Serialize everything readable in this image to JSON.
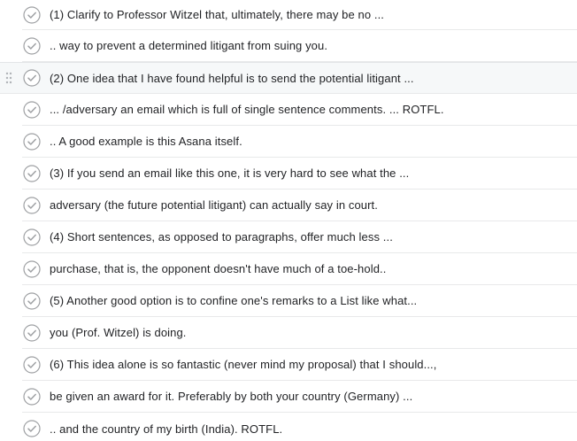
{
  "tasks": [
    {
      "text": "(1) Clarify to Professor Witzel that, ultimately, there may be no ..."
    },
    {
      "text": ".. way to prevent a determined litigant from suing you."
    },
    {
      "text": "(2) One idea that I have found helpful is to send the potential litigant ..."
    },
    {
      "text": "... /adversary an email which is full of single sentence comments.  ... ROTFL."
    },
    {
      "text": ".. A good example is this Asana itself."
    },
    {
      "text": "(3) If you send an email like this one, it is very hard to see what the ..."
    },
    {
      "text": " adversary (the future potential litigant) can actually say in court."
    },
    {
      "text": "(4) Short sentences, as opposed to paragraphs, offer much less ..."
    },
    {
      "text": "purchase, that is, the opponent doesn't have much of a toe-hold.."
    },
    {
      "text": "(5) Another good option is to confine one's remarks to a List like what..."
    },
    {
      "text": "you (Prof. Witzel) is doing."
    },
    {
      "text": "(6) This idea alone is so fantastic (never mind my proposal) that I should...,"
    },
    {
      "text": "be given an award for it. Preferably by both your country (Germany) ..."
    },
    {
      "text": ".. and the country of my birth (India). ROTFL."
    }
  ]
}
